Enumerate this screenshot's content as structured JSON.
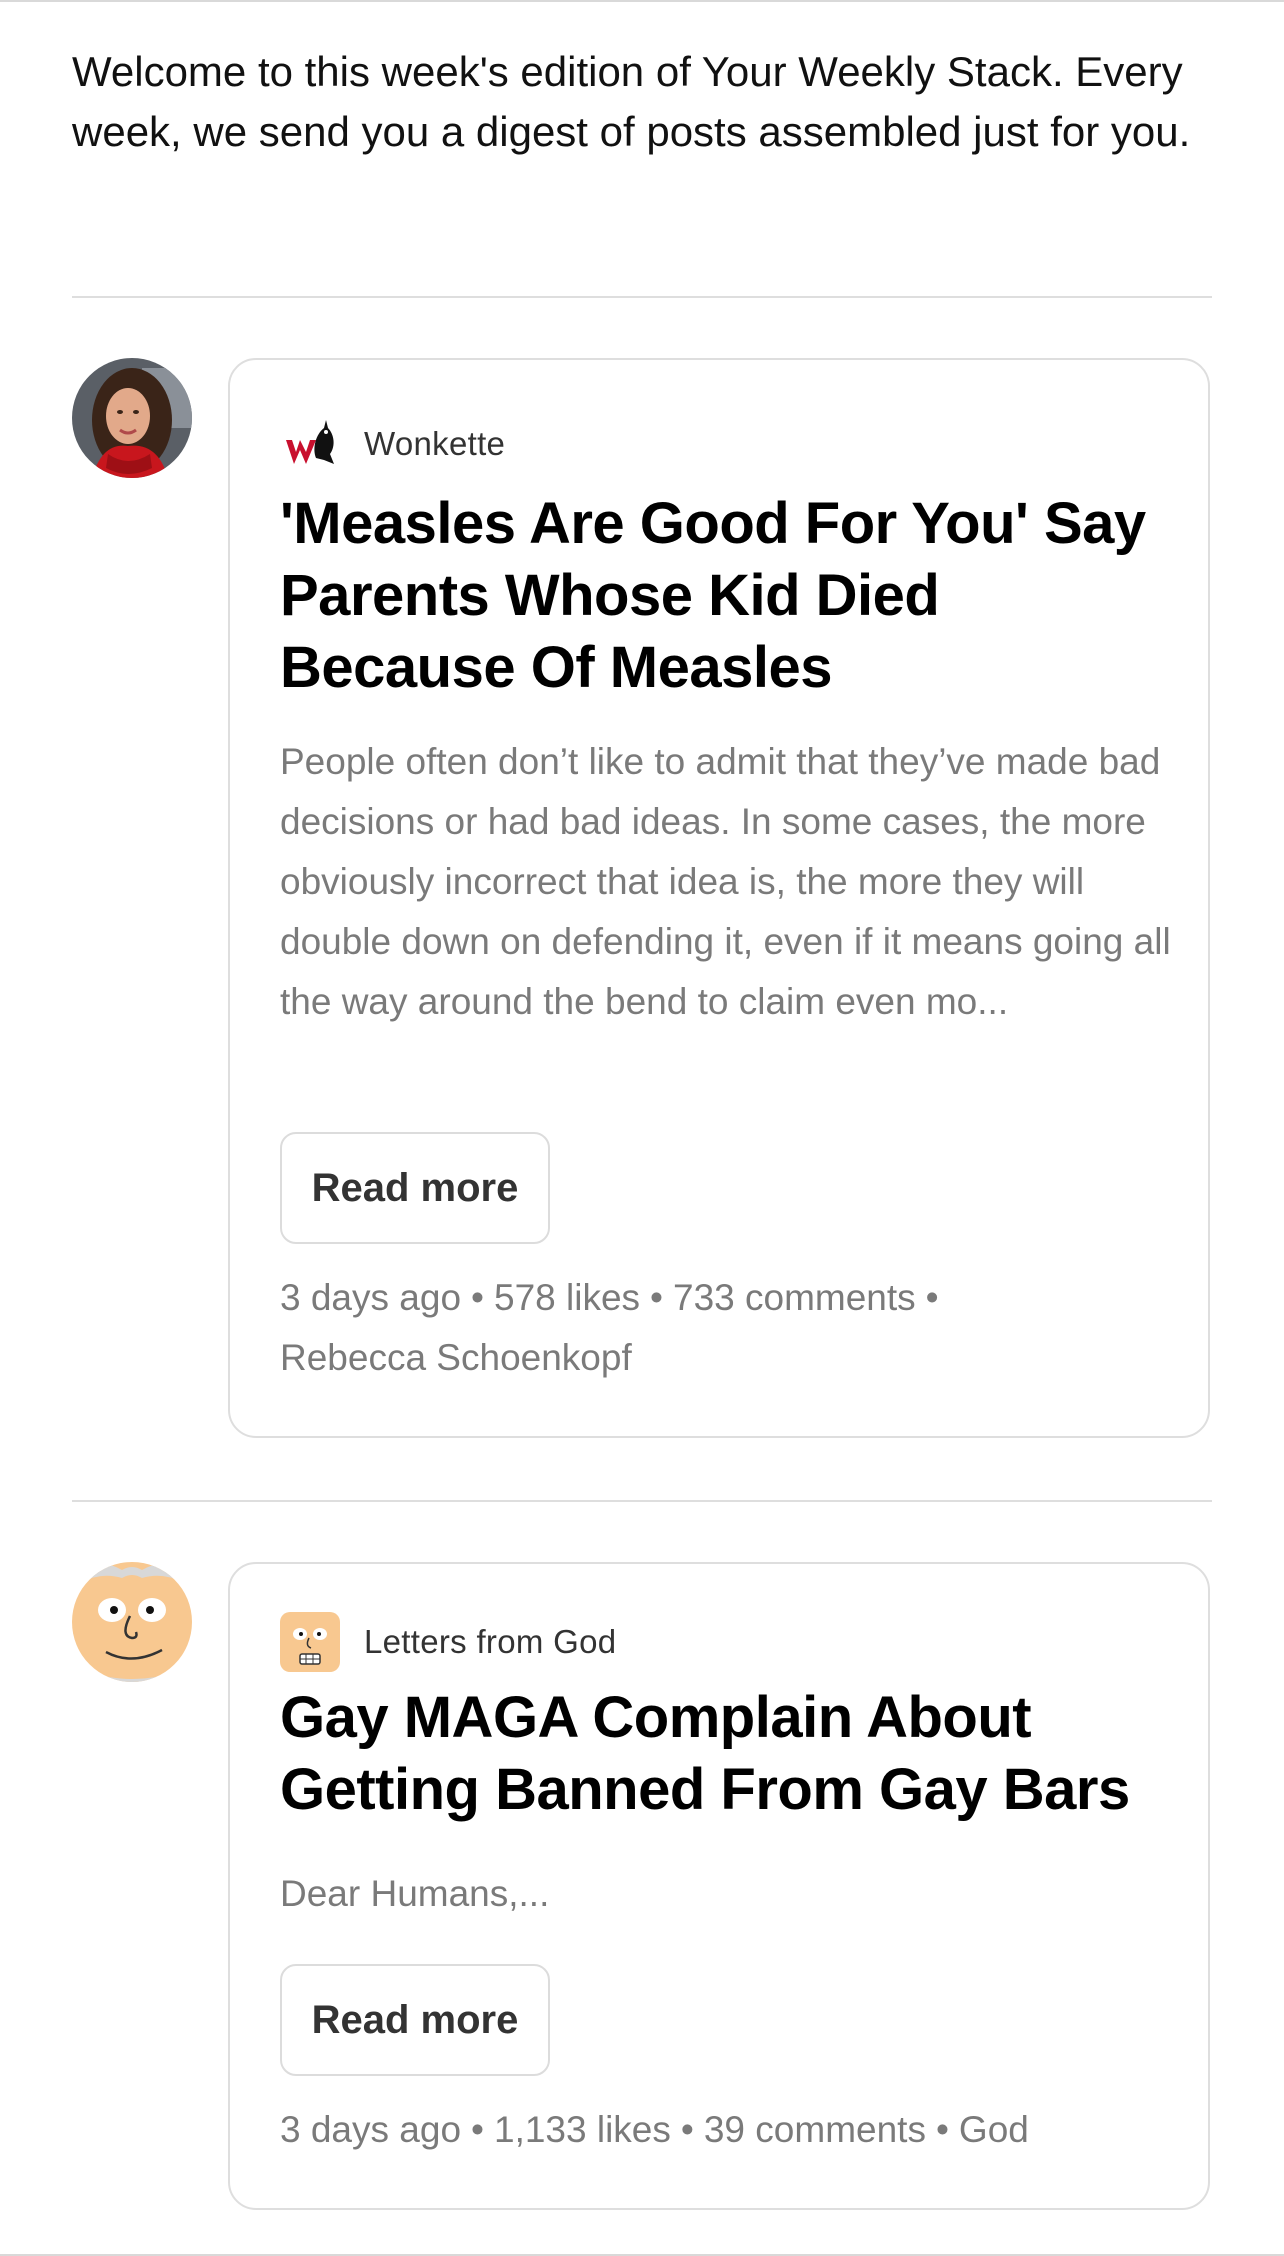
{
  "intro": {
    "text": "Welcome to this week's edition of Your Weekly Stack. Every week, we send you a digest of posts assembled just for you."
  },
  "posts": [
    {
      "publication": "Wonkette",
      "title": "'Measles Are Good For You' Say Parents Whose Kid Died Because Of Measles",
      "excerpt": "People often don’t like to admit that they’ve made bad decisions or had bad ideas. In some cases, the more obviously incorrect that idea is, the more they will double down on defending it, even if it means going all the way around the bend to claim even mo...",
      "read_more_label": "Read more",
      "time_ago": "3 days ago",
      "likes": "578 likes",
      "comments": "733 comments",
      "author": "Rebecca Schoenkopf",
      "avatar_icon": "author-photo-avatar",
      "logo_icon": "wonkette-logo"
    },
    {
      "publication": "Letters from God",
      "title": "Gay MAGA Complain About Getting Banned From Gay Bars",
      "excerpt": "Dear Humans,...",
      "read_more_label": "Read more",
      "time_ago": "3 days ago",
      "likes": "1,133 likes",
      "comments": "39 comments",
      "author": "God",
      "avatar_icon": "cartoon-face-avatar",
      "logo_icon": "cartoon-face-logo"
    }
  ],
  "separator": "•",
  "colors": {
    "text_primary": "#111111",
    "text_muted": "#7a7a7a",
    "border": "#dedede",
    "wonkette_red": "#c8102e",
    "cartoon_skin": "#f8c890"
  }
}
